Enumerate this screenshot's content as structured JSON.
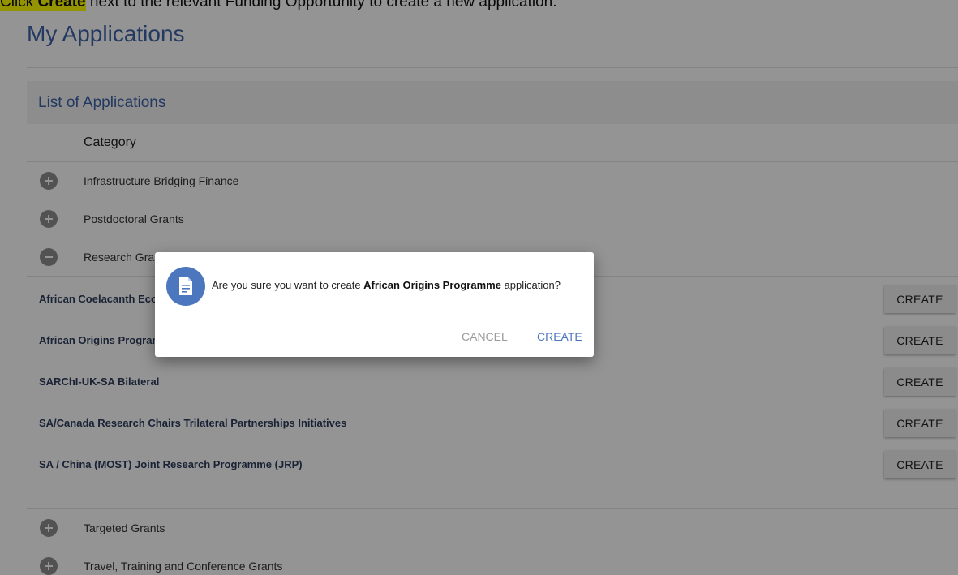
{
  "instruction": {
    "prefix": "Click ",
    "bold": "Create",
    "suffix": " next to the relevant Funding Opportunity to create a new application."
  },
  "page": {
    "title": "My Applications"
  },
  "panel": {
    "title": "List of Applications",
    "column_header": "Category"
  },
  "categories_top": [
    {
      "label": "Infrastructure Bridging Finance",
      "icon": "plus-circle-icon"
    },
    {
      "label": "Postdoctoral Grants",
      "icon": "plus-circle-icon"
    },
    {
      "label": "Research Grants",
      "icon": "minus-circle-icon"
    }
  ],
  "programmes": [
    {
      "name": "African Coelacanth Ecosystem Programme",
      "button": "CREATE"
    },
    {
      "name": "African Origins Programme",
      "button": "CREATE"
    },
    {
      "name": "SARChI-UK-SA Bilateral",
      "button": "CREATE"
    },
    {
      "name": "SA/Canada Research Chairs Trilateral Partnerships Initiatives",
      "button": "CREATE"
    },
    {
      "name": "SA / China (MOST) Joint Research Programme (JRP)",
      "button": "CREATE"
    }
  ],
  "categories_bottom": [
    {
      "label": "Targeted Grants",
      "icon": "plus-circle-icon"
    },
    {
      "label": "Travel, Training and Conference Grants",
      "icon": "plus-circle-icon"
    }
  ],
  "dialog": {
    "icon": "document-icon",
    "text_before": "Are you sure you want to create ",
    "text_bold": "African Origins Programme",
    "text_after": " application?",
    "cancel_label": "CANCEL",
    "create_label": "CREATE"
  },
  "colors": {
    "accent": "#3d63a8",
    "dialog_icon_bg": "#4c76be",
    "highlight": "#ffff00"
  }
}
